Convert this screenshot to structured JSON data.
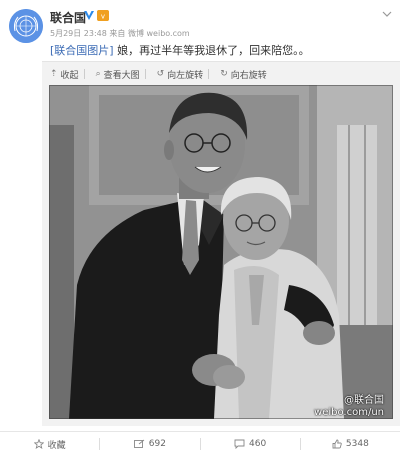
{
  "post": {
    "username": "联合国",
    "timestamp": "5月29日 23:48",
    "source_prefix": "来自",
    "source": "微博 weibo.com",
    "text_tag": "[联合国图片]",
    "text_body": "娘，再过半年等我退休了，回来陪您。。"
  },
  "toolbar": {
    "collapse": "收起",
    "view_large": "查看大图",
    "rotate_left": "向左旋转",
    "rotate_right": "向右旋转"
  },
  "watermark": {
    "line1": "@联合国",
    "line2": "weibo.com/un"
  },
  "footer": {
    "favorite": "收藏",
    "repost_count": "692",
    "comment_count": "460",
    "like_count": "5348"
  },
  "icons": {
    "toolbar_collapse": "arrow-up-icon",
    "toolbar_view": "magnifier-icon",
    "toolbar_rotate_left": "rotate-left-icon",
    "toolbar_rotate_right": "rotate-right-icon",
    "footer_favorite": "star-icon",
    "footer_repost": "repost-icon",
    "footer_comment": "comment-icon",
    "footer_like": "thumbs-up-icon"
  },
  "colors": {
    "link": "#3b6bb5",
    "verified": "#2d8ae8",
    "vip": "#f0a020"
  }
}
